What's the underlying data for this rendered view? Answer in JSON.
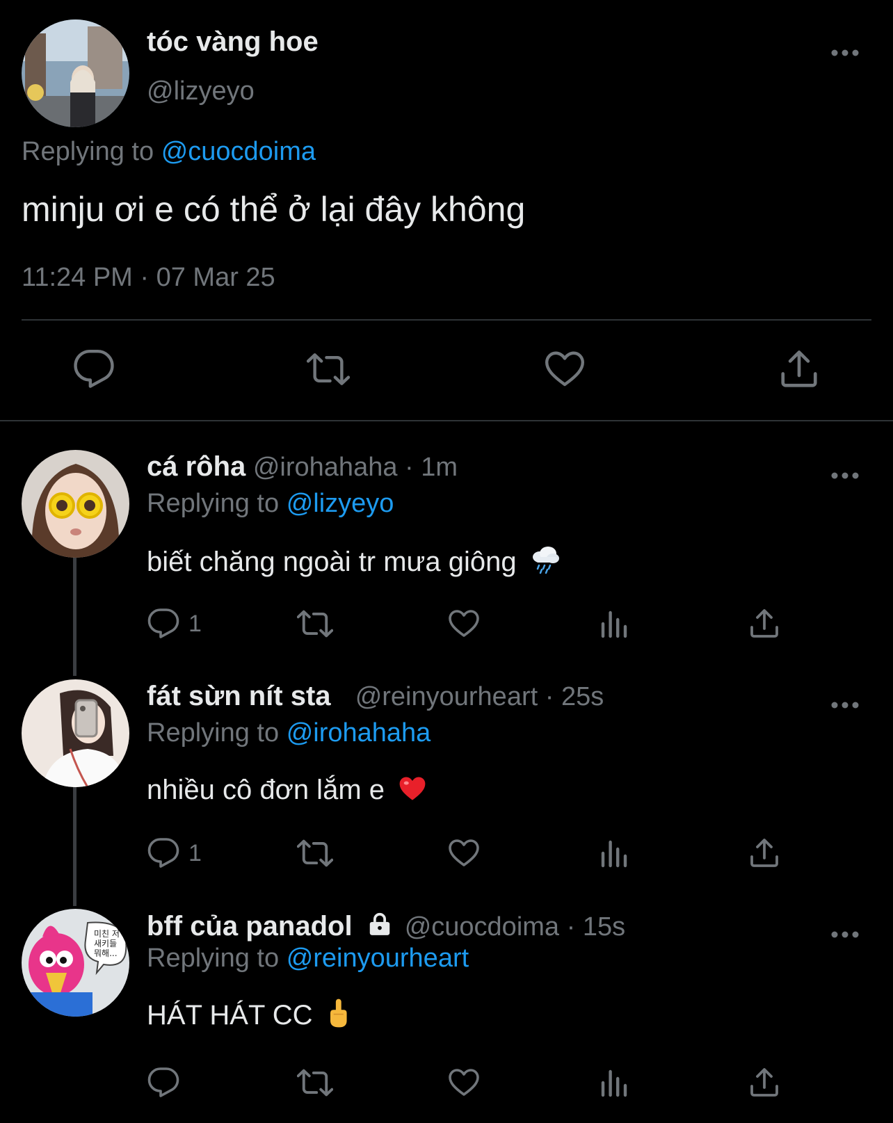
{
  "main_tweet": {
    "display_name": "tóc vàng hoe",
    "handle": "@lizyeyo",
    "replying_prefix": "Replying to",
    "replying_to": "@cuocdoima",
    "text": "minju ơi e có thể ở lại đây không",
    "timestamp": "11:24 PM · 07 Mar 25",
    "actions": [
      "reply-icon",
      "retweet-icon",
      "like-icon",
      "share-icon"
    ]
  },
  "replies": [
    {
      "display_name": "cá rôha",
      "handle": "@irohahaha",
      "time": "· 1m",
      "replying_prefix": "Replying to",
      "replying_to": "@lizyeyo",
      "text": "biết chăng ngoài tr mưa giông",
      "emoji": "rain-cloud-emoji",
      "reply_count": "1"
    },
    {
      "display_name": "fát sừn nít sta",
      "handle": "@reinyourheart",
      "time": "· 25s",
      "replying_prefix": "Replying to",
      "replying_to": "@irohahaha",
      "text": "nhiều cô đơn lắm e",
      "emoji": "red-heart-emoji",
      "reply_count": "1"
    },
    {
      "display_name": "bff của panadol",
      "handle": "@cuocdoima",
      "time": "· 15s",
      "replying_prefix": "Replying to",
      "replying_to": "@reinyourheart",
      "text": "HÁT HÁT CC",
      "emoji": "middle-finger-emoji",
      "reply_count": "",
      "locked": true
    }
  ],
  "avatar_bubble_text": "미친 저\n새키들\n뭐해...",
  "colors": {
    "background": "#000000",
    "text_primary": "#e7e9ea",
    "text_secondary": "#71767b",
    "accent": "#1d9bf0",
    "divider": "#2f3336"
  }
}
